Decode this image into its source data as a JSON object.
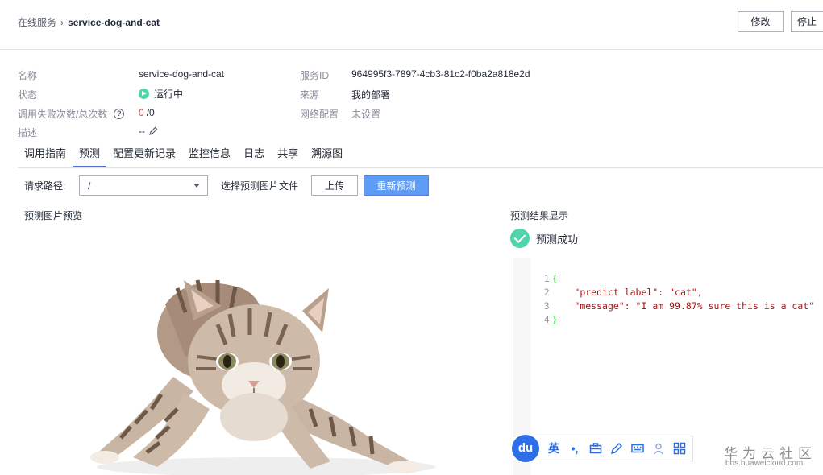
{
  "header": {
    "breadcrumb_parent": "在线服务",
    "breadcrumb_sep": "›",
    "breadcrumb_current": "service-dog-and-cat",
    "modify_label": "修改",
    "stop_label": "停止"
  },
  "info": {
    "name_label": "名称",
    "name_value": "service-dog-and-cat",
    "status_label": "状态",
    "status_value": "运行中",
    "calls_label": "调用失败次数/总次数",
    "calls_fail": "0",
    "calls_total": "/0",
    "desc_label": "描述",
    "desc_value": "--",
    "service_id_label": "服务ID",
    "service_id_value": "964995f3-7897-4cb3-81c2-f0ba2a818e2d",
    "source_label": "来源",
    "source_value": "我的部署",
    "network_label": "网络配置",
    "network_value": "未设置"
  },
  "tabs": [
    {
      "label": "调用指南"
    },
    {
      "label": "预测"
    },
    {
      "label": "配置更新记录"
    },
    {
      "label": "监控信息"
    },
    {
      "label": "日志"
    },
    {
      "label": "共享"
    },
    {
      "label": "溯源图"
    }
  ],
  "active_tab": "预测",
  "predict": {
    "request_path_label": "请求路径:",
    "request_path_value": "/",
    "select_file_label": "选择预测图片文件",
    "upload_label": "上传",
    "repredict_label": "重新预测",
    "preview_title": "预测图片预览",
    "result_title": "预测结果显示",
    "success_label": "预测成功"
  },
  "result_code": {
    "lines": [
      {
        "num": "1",
        "text": "{"
      },
      {
        "num": "2",
        "text": "    \"predict label\": \"cat\","
      },
      {
        "num": "3",
        "text": "    \"message\": \"I am 99.87% sure this is a cat\""
      },
      {
        "num": "4",
        "text": "}"
      }
    ]
  },
  "ime": {
    "logo": "du",
    "lang": "英",
    "punct": "•,"
  },
  "watermark": {
    "title": "华为云社区",
    "url": "bbs.huaweicloud.com"
  },
  "colors": {
    "accent": "#5e9cf5",
    "success": "#50d4ab",
    "error": "#e53935",
    "tab_active": "#526ecc"
  }
}
